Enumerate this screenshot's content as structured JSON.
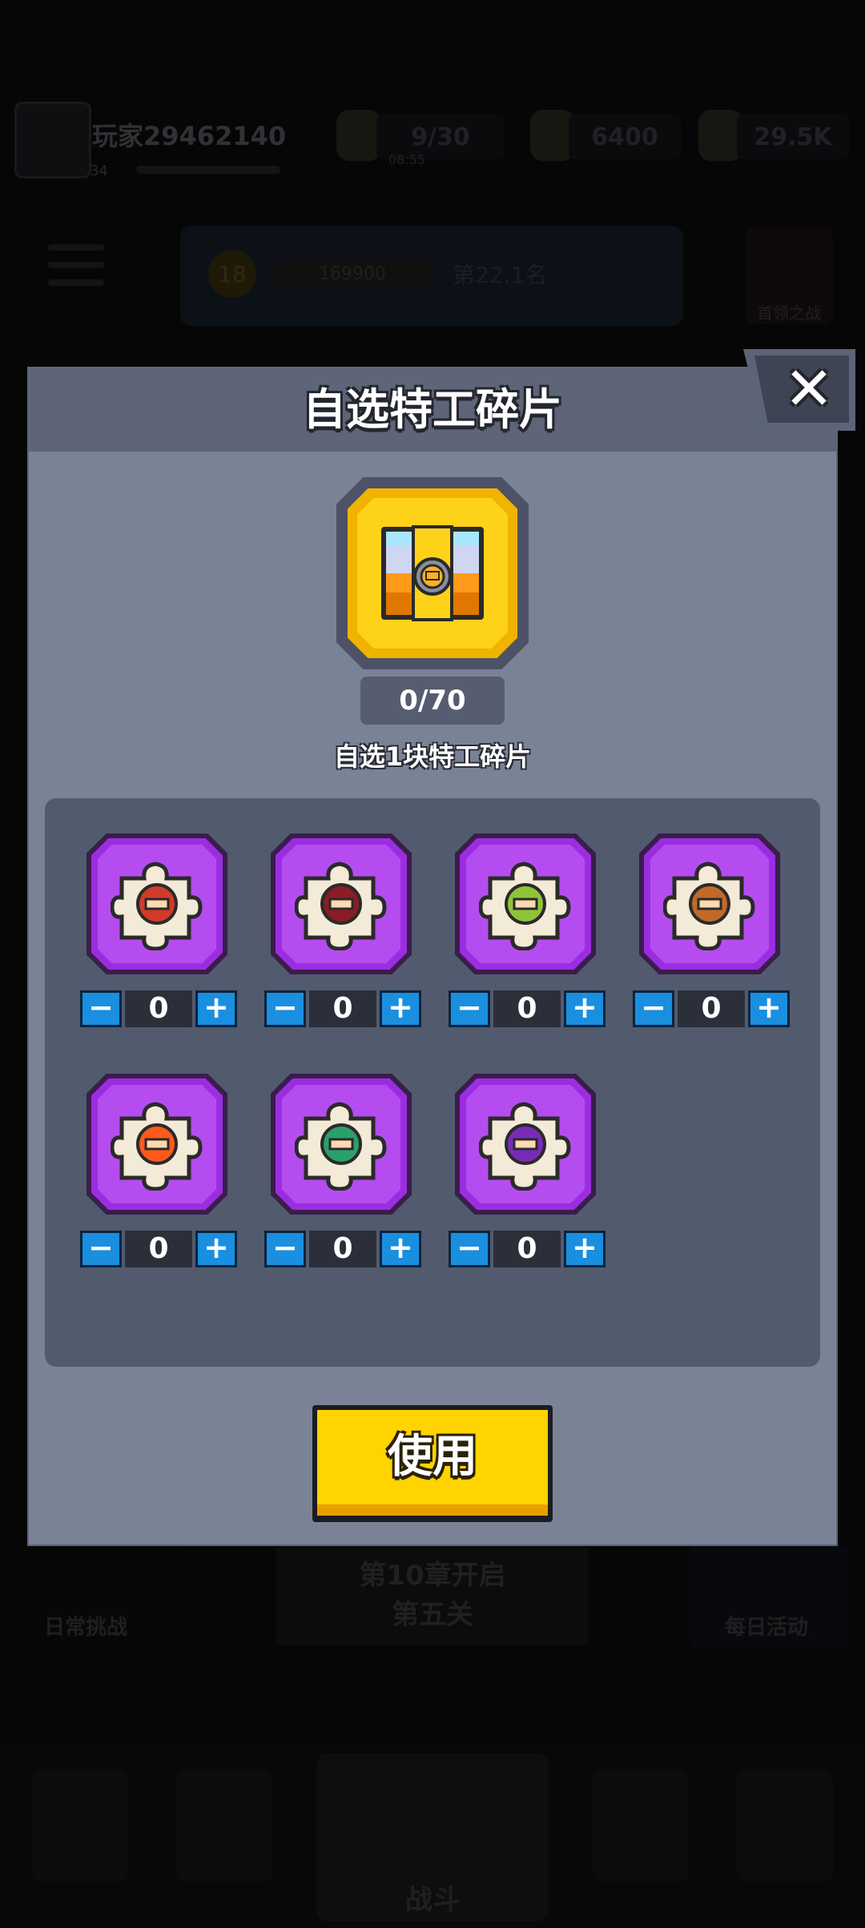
{
  "background": {
    "player_name": "玩家29462140",
    "player_level": "34",
    "energy": "9/30",
    "energy_timer": "08:55",
    "currency_1": "6400",
    "currency_2": "29.5K",
    "level_badge": "18",
    "level_value": "169900",
    "rank_text": "第22.1名",
    "boss_label": "首领之战",
    "left_event_label": "日常挑战",
    "center_box_line1": "第10章开启",
    "center_box_line2": "第五关",
    "right_event_label": "每日活动",
    "battle_label": "战斗"
  },
  "modal": {
    "title": "自选特工碎片",
    "progress": "0/70",
    "subtitle": "自选1块特工碎片",
    "use_button": "使用",
    "close_icon": "close-icon",
    "items": [
      {
        "qty": "0",
        "minus": "−",
        "plus": "+",
        "color": "#d23a2a"
      },
      {
        "qty": "0",
        "minus": "−",
        "plus": "+",
        "color": "#8a1c24"
      },
      {
        "qty": "0",
        "minus": "−",
        "plus": "+",
        "color": "#8fc43a"
      },
      {
        "qty": "0",
        "minus": "−",
        "plus": "+",
        "color": "#c06a2a"
      },
      {
        "qty": "0",
        "minus": "−",
        "plus": "+",
        "color": "#ff5a1a"
      },
      {
        "qty": "0",
        "minus": "−",
        "plus": "+",
        "color": "#2aa06a"
      },
      {
        "qty": "0",
        "minus": "−",
        "plus": "+",
        "color": "#7a2ab8"
      }
    ]
  },
  "colors": {
    "modal_bg": "#7a8296",
    "tile_purple": "#b54cf0",
    "stepper_blue": "#1a8fe0",
    "use_yellow": "#ffd400"
  }
}
